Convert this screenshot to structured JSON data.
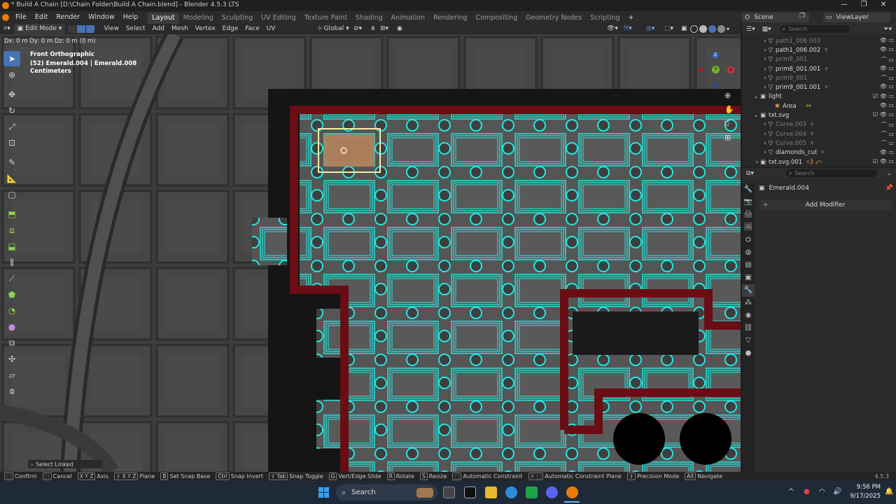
{
  "window": {
    "title": "* Build A Chain [D:\\Chain Folder\\Build A Chain.blend] - Blender 4.5.3 LTS",
    "minimize": "—",
    "maximize": "❐",
    "close": "✕"
  },
  "menu": {
    "items": [
      "File",
      "Edit",
      "Render",
      "Window",
      "Help"
    ]
  },
  "workspaces": {
    "tabs": [
      "Layout",
      "Modeling",
      "Sculpting",
      "UV Editing",
      "Texture Paint",
      "Shading",
      "Animation",
      "Rendering",
      "Compositing",
      "Geometry Nodes",
      "Scripting"
    ],
    "active_index": 0,
    "add": "+"
  },
  "scene": {
    "name": "Scene",
    "view_layer": "ViewLayer"
  },
  "viewport_header": {
    "mode": "Edit Mode",
    "menus": [
      "View",
      "Select",
      "Add",
      "Mesh",
      "Vertex",
      "Edge",
      "Face",
      "UV"
    ],
    "transform_orientation": "Global"
  },
  "viewport": {
    "operator_status": "Dx: 0 m   Dy: 0 m   Dz: 0 m (0 m)",
    "view_name": "Front Orthographic",
    "object_info": "(52) Emerald.004 | Emerald.008",
    "units": "Centimeters",
    "last_op": "Select Linked",
    "gizmo": {
      "z": "Z",
      "y": "Y",
      "x": "X"
    },
    "colors": {
      "mesh_wire": "#22e8e0",
      "selected_face": "#b3805a",
      "frame": "#6a0d14"
    }
  },
  "outliner": {
    "search_placeholder": "Search",
    "rows": [
      {
        "name": "path1_006.003",
        "dim": true
      },
      {
        "name": "path1_006.002",
        "dim": false
      },
      {
        "name": "prim8_001",
        "dim": true
      },
      {
        "name": "prim8_001.001",
        "dim": false
      },
      {
        "name": "prim9_001",
        "dim": true
      },
      {
        "name": "prim9_001.001",
        "dim": false
      },
      {
        "name": "light",
        "dim": false
      },
      {
        "name": "Area",
        "dim": false
      },
      {
        "name": "txt.svg",
        "dim": false
      },
      {
        "name": "Curve.003",
        "dim": true
      },
      {
        "name": "Curve.004",
        "dim": true
      },
      {
        "name": "Curve.005",
        "dim": true
      },
      {
        "name": "diamonds_cut",
        "dim": false
      },
      {
        "name": "txt.svg.001",
        "dim": false
      }
    ]
  },
  "properties": {
    "search_placeholder": "Search",
    "object_name": "Emerald.004",
    "add_modifier": "Add Modifier"
  },
  "statusbar": {
    "items": [
      {
        "key": "⬚",
        "label": "Confirm"
      },
      {
        "key": "⬚",
        "label": "Cancel"
      },
      {
        "key": "X Y Z",
        "label": "Axis"
      },
      {
        "key": "⇧ X Y Z",
        "label": "Plane"
      },
      {
        "key": "B",
        "label": "Set Snap Base"
      },
      {
        "key": "Ctrl",
        "label": "Snap Invert"
      },
      {
        "key": "⇧ Tab",
        "label": "Snap Toggle"
      },
      {
        "key": "G",
        "label": "Vert/Edge Slide"
      },
      {
        "key": "R",
        "label": "Rotate"
      },
      {
        "key": "S",
        "label": "Resize"
      },
      {
        "key": "⬚",
        "label": "Automatic Constraint"
      },
      {
        "key": "⇧ ⬚",
        "label": "Automatic Constraint Plane"
      },
      {
        "key": "⇧",
        "label": "Precision Mode"
      },
      {
        "key": "Alt",
        "label": "Navigate"
      }
    ],
    "version": "4.5.3"
  },
  "taskbar": {
    "search": "Search",
    "time": "9:56 PM",
    "date": "9/17/2025"
  }
}
